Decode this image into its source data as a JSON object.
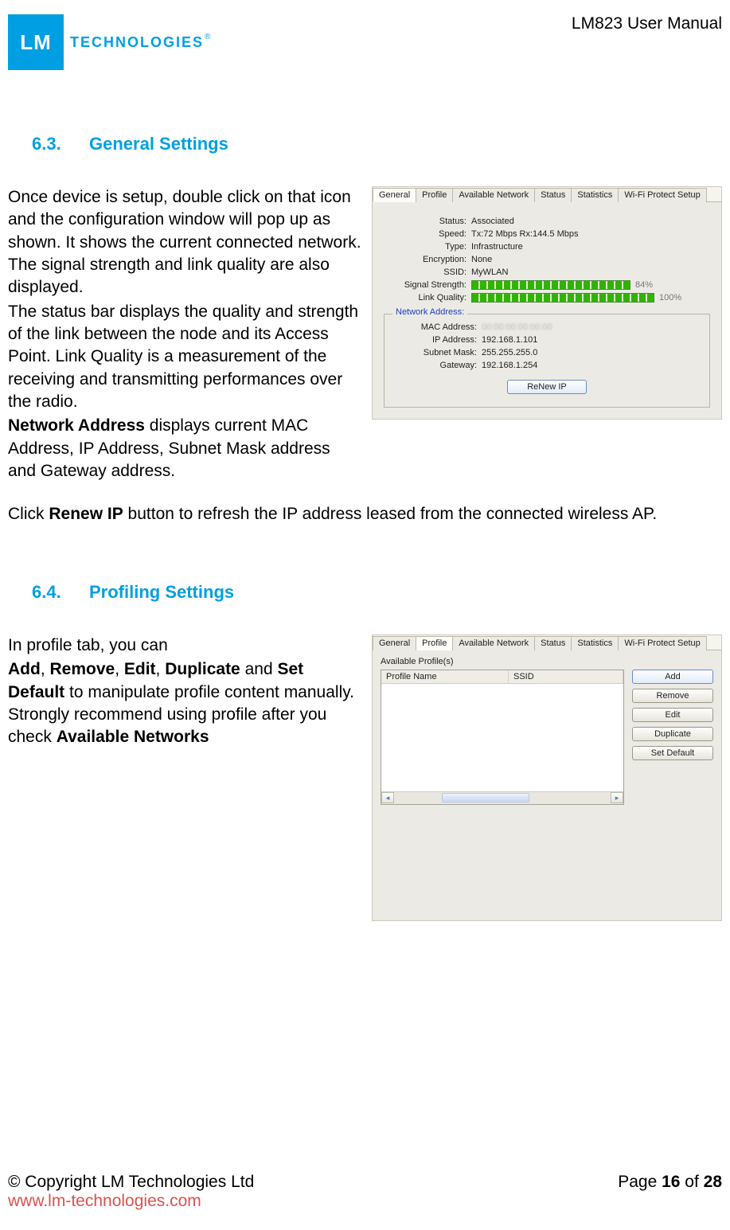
{
  "header": {
    "logo_square": "LM",
    "logo_word": "TECHNOLOGIES",
    "logo_reg": "®",
    "doc_title": "LM823 User Manual"
  },
  "section63": {
    "num": "6.3.",
    "title": "General Settings",
    "para1": "Once device is setup, double click on that icon and the configuration window will pop up as shown. It shows the current connected network. The signal strength and link quality are also displayed.",
    "para2": "The status bar displays the quality and strength of the link between the node and its Access Point. Link Quality is a measurement of the receiving and transmitting performances over the radio.",
    "para3_lead": "Network Address",
    "para3_rest": " displays current MAC Address, IP Address, Subnet Mask address and Gateway address.",
    "para4_pre": "Click ",
    "para4_bold": "Renew IP",
    "para4_post": " button to refresh the IP address leased from the connected wireless AP."
  },
  "general_panel": {
    "tabs": [
      "General",
      "Profile",
      "Available Network",
      "Status",
      "Statistics",
      "Wi-Fi Protect Setup"
    ],
    "active_tab": "General",
    "fields": {
      "Status": "Associated",
      "Speed": "Tx:72 Mbps Rx:144.5 Mbps",
      "Type": "Infrastructure",
      "Encryption": "None",
      "SSID": "MyWLAN",
      "SignalStrengthLabel": "Signal Strength:",
      "SignalStrengthPct": "84%",
      "LinkQualityLabel": "Link Quality:",
      "LinkQualityPct": "100%"
    },
    "network_address": {
      "legend": "Network Address:",
      "MAC_label": "MAC Address:",
      "MAC_value": "",
      "IP_label": "IP Address:",
      "IP_value": "192.168.1.101",
      "Subnet_label": "Subnet Mask:",
      "Subnet_value": "255.255.255.0",
      "Gateway_label": "Gateway:",
      "Gateway_value": "192.168.1.254"
    },
    "renew_btn": "ReNew IP"
  },
  "section64": {
    "num": "6.4.",
    "title": "Profiling Settings",
    "line1": "In profile tab, you can",
    "b1": "Add",
    "c1": ", ",
    "b2": "Remove",
    "c2": ", ",
    "b3": "Edit",
    "c3": ", ",
    "b4": "Duplicate",
    "c4": " and ",
    "b5": "Set Default",
    "rest1": " to manipulate profile content manually. Strongly recommend using profile after you check ",
    "b6": "Available Networks"
  },
  "profile_panel": {
    "tabs": [
      "General",
      "Profile",
      "Available Network",
      "Status",
      "Statistics",
      "Wi-Fi Protect Setup"
    ],
    "active_tab": "Profile",
    "group_label": "Available Profile(s)",
    "col1": "Profile Name",
    "col2": "SSID",
    "buttons": [
      "Add",
      "Remove",
      "Edit",
      "Duplicate",
      "Set Default"
    ]
  },
  "footer": {
    "copyright": "© Copyright LM Technologies Ltd",
    "url": "www.lm-technologies.com",
    "page_pre": "Page ",
    "page_cur": "16",
    "page_mid": " of ",
    "page_tot": "28"
  }
}
